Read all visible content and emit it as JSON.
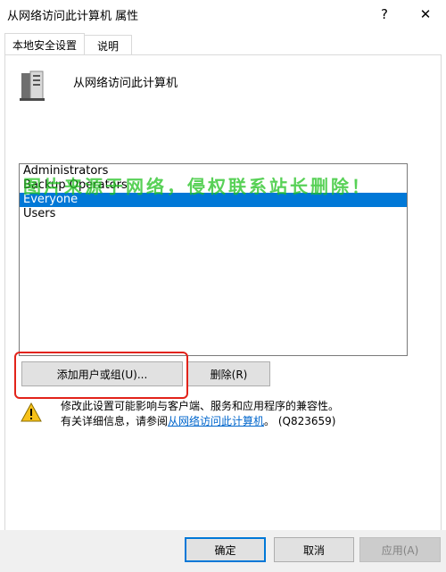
{
  "window": {
    "title": "从网络访问此计算机 属性",
    "help_glyph": "?",
    "close_glyph": "✕"
  },
  "tabs": [
    {
      "label": "本地安全设置",
      "active": true
    },
    {
      "label": "说明",
      "active": false
    }
  ],
  "policy": {
    "icon": "server-icon",
    "name": "从网络访问此计算机"
  },
  "accounts": {
    "items": [
      "Administrators",
      "Backup Operators",
      "Everyone",
      "Users"
    ],
    "selected": "Everyone"
  },
  "watermark": "图片来源于网络，侵权联系站长删除！",
  "buttons": {
    "add": "添加用户或组(U)...",
    "remove": "删除(R)"
  },
  "warning": {
    "icon": "warning-icon",
    "line1": "修改此设置可能影响与客户端、服务和应用程序的兼容性。",
    "line2_prefix": "有关详细信息，请参阅",
    "link": "从网络访问此计算机",
    "line2_suffix": "。 (Q823659)"
  },
  "footer": {
    "ok": "确定",
    "cancel": "取消",
    "apply": "应用(A)"
  },
  "colors": {
    "selection": "#0078d7",
    "highlight_box": "#e2231a",
    "watermark": "#21c21f",
    "link": "#0066cc"
  }
}
